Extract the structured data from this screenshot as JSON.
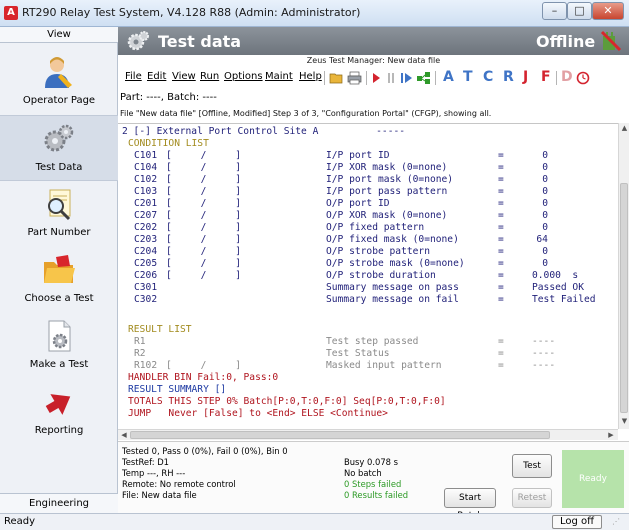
{
  "window": {
    "title": "RT290 Relay Test System, V4.128 R88 (Admin: Administrator)",
    "app_icon": "A",
    "close_glyph": "✕",
    "max_glyph": "□",
    "min_glyph": "–"
  },
  "sidebar": {
    "view_label": "View",
    "items": [
      {
        "label": "Operator Page",
        "icon": "operator-person-icon"
      },
      {
        "label": "Test Data",
        "icon": "gears-icon"
      },
      {
        "label": "Part Number",
        "icon": "magnifier-document-icon"
      },
      {
        "label": "Choose a Test",
        "icon": "folder-icon"
      },
      {
        "label": "Make a Test",
        "icon": "document-gear-icon"
      },
      {
        "label": "Reporting",
        "icon": "red-arrow-icon"
      }
    ],
    "engineering_label": "Engineering"
  },
  "header": {
    "title": "Test data",
    "status": "Offline"
  },
  "subtitle": "Zeus Test Manager: New data file",
  "menu": {
    "items": [
      "File",
      "Edit",
      "View",
      "Run",
      "Options",
      "Maint",
      "Help"
    ],
    "letters": [
      "A",
      "T",
      "C",
      "R",
      "J",
      "F",
      "D"
    ],
    "colors": {
      "accent_red": "#d4242f",
      "accent_blue": "#3f74c6",
      "accent_green": "#2f9a2a"
    }
  },
  "part_line": "Part: ----, Batch: ----",
  "file_info": "File \"New data file\" [Offline, Modified] Step 3 of 3, \"Configuration Portal\" (CFGP), showing all.",
  "code": {
    "header_line": "2 [-] External Port Control Site A          -----",
    "condition_title": "CONDITION LIST",
    "conditions": [
      {
        "id": "C101",
        "bracket": "[     /     ]",
        "desc": "I/P port ID",
        "eq": "=",
        "val": "0"
      },
      {
        "id": "C104",
        "bracket": "[     /     ]",
        "desc": "I/P XOR mask (0=none)",
        "eq": "=",
        "val": "0"
      },
      {
        "id": "C102",
        "bracket": "[     /     ]",
        "desc": "I/P port mask (0=none)",
        "eq": "=",
        "val": "0"
      },
      {
        "id": "C103",
        "bracket": "[     /     ]",
        "desc": "I/P port pass pattern",
        "eq": "=",
        "val": "0"
      },
      {
        "id": "C201",
        "bracket": "[     /     ]",
        "desc": "O/P port ID",
        "eq": "=",
        "val": "0"
      },
      {
        "id": "C207",
        "bracket": "[     /     ]",
        "desc": "O/P XOR mask (0=none)",
        "eq": "=",
        "val": "0"
      },
      {
        "id": "C202",
        "bracket": "[     /     ]",
        "desc": "O/P fixed pattern",
        "eq": "=",
        "val": "0"
      },
      {
        "id": "C203",
        "bracket": "[     /     ]",
        "desc": "O/P fixed mask (0=none)",
        "eq": "=",
        "val": "64"
      },
      {
        "id": "C204",
        "bracket": "[     /     ]",
        "desc": "O/P strobe pattern",
        "eq": "=",
        "val": "0"
      },
      {
        "id": "C205",
        "bracket": "[     /     ]",
        "desc": "O/P strobe mask (0=none)",
        "eq": "=",
        "val": "0"
      },
      {
        "id": "C206",
        "bracket": "[     /     ]",
        "desc": "O/P strobe duration",
        "eq": "=",
        "val": "0.000  s"
      },
      {
        "id": "C301",
        "bracket": "",
        "desc": "Summary message on pass",
        "eq": "=",
        "val": "Passed OK"
      },
      {
        "id": "C302",
        "bracket": "",
        "desc": "Summary message on fail",
        "eq": "=",
        "val": "Test Failed"
      }
    ],
    "result_title": "RESULT LIST",
    "results": [
      {
        "id": "R1",
        "bracket": "",
        "desc": "Test step passed",
        "eq": "=",
        "val": "----"
      },
      {
        "id": "R2",
        "bracket": "",
        "desc": "Test Status",
        "eq": "=",
        "val": "----"
      },
      {
        "id": "R102",
        "bracket": "[     /     ]",
        "desc": "Masked input pattern",
        "eq": "=",
        "val": "----"
      }
    ],
    "handler_line": "HANDLER BIN Fail:0, Pass:0",
    "summary_line": "RESULT SUMMARY []",
    "totals_line": "TOTALS THIS STEP 0% Batch[P:0,T:0,F:0] Seq[P:0,T:0,F:0]",
    "jump_line": "JUMP   Never [False] to <End> ELSE <Continue>"
  },
  "status": {
    "tested": "Tested 0, Pass 0 (0%), Fail 0 (0%), Bin 0",
    "testref": "TestRef: D1",
    "temp": "Temp ---, RH ---",
    "remote": "Remote: No remote control",
    "file": "File: New data file",
    "busy": "Busy 0.078 s",
    "batch": "No batch",
    "steps_failed": "0 Steps failed",
    "results_failed": "0 Results failed",
    "test_button": "Test",
    "start_batch_button": "Start Batch",
    "retest_button": "Retest",
    "ready_label": "Ready"
  },
  "bottom": {
    "ready": "Ready",
    "logoff": "Log off"
  }
}
